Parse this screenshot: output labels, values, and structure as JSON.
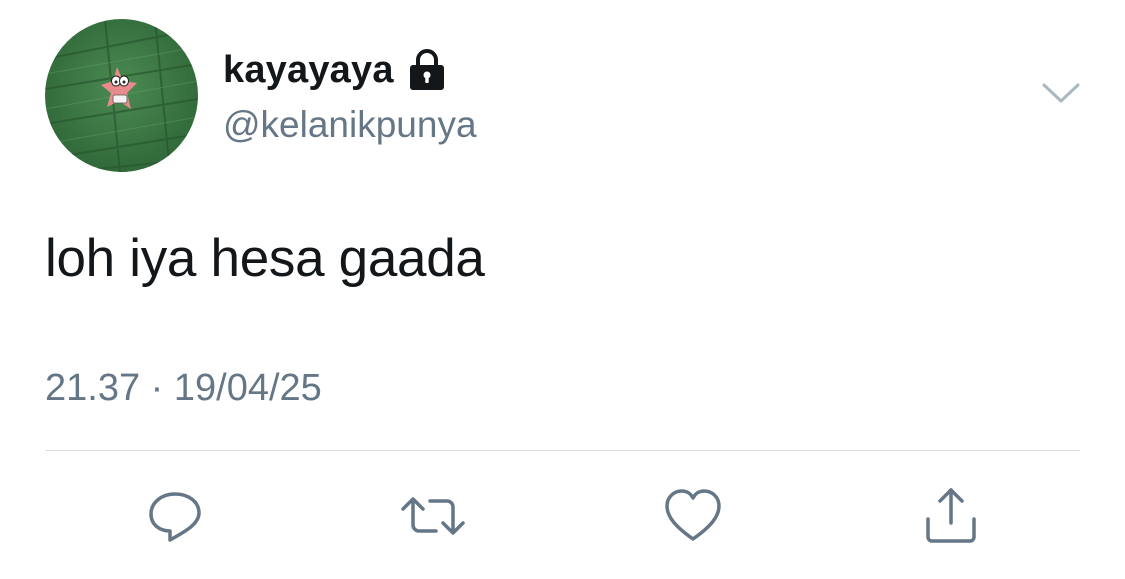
{
  "tweet": {
    "display_name": "kayayaya",
    "handle": "@kelanikpunya",
    "text": "loh iya hesa gaada",
    "timestamp": "21.37 · 19/04/25"
  },
  "icons": {
    "lock": "lock-icon",
    "caret": "chevron-down-icon",
    "reply": "reply-icon",
    "retweet": "retweet-icon",
    "like": "heart-icon",
    "share": "share-icon"
  },
  "colors": {
    "text": "#14171a",
    "secondary": "#657786",
    "divider": "#d9dde1",
    "avatar_bg": "#3e7a46"
  }
}
